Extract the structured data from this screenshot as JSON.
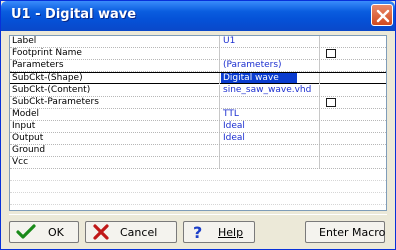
{
  "window": {
    "title": "U1 - Digital wave"
  },
  "properties": [
    {
      "label": "Label",
      "value": "U1",
      "checkbox": false
    },
    {
      "label": "Footprint Name",
      "value": "",
      "checkbox": true
    },
    {
      "label": "Parameters",
      "value": "(Parameters)",
      "checkbox": false
    },
    {
      "label": "SubCkt-(Shape)",
      "value": "Digital wave",
      "checkbox": false,
      "editing": true
    },
    {
      "label": "SubCkt-(Content)",
      "value": "sine_saw_wave.vhd",
      "checkbox": false
    },
    {
      "label": "SubCkt-Parameters",
      "value": "",
      "checkbox": true
    },
    {
      "label": "Model",
      "value": "TTL",
      "checkbox": false
    },
    {
      "label": "Input",
      "value": "Ideal",
      "checkbox": false
    },
    {
      "label": "Output",
      "value": "Ideal",
      "checkbox": false
    },
    {
      "label": "Ground",
      "value": "",
      "checkbox": false
    },
    {
      "label": "Vcc",
      "value": "",
      "checkbox": false
    }
  ],
  "buttons": {
    "ok": {
      "label": "OK",
      "icon": "checkmark-icon"
    },
    "cancel": {
      "label": "Cancel",
      "icon": "x-icon"
    },
    "help": {
      "label": "Help",
      "icon": "question-icon"
    },
    "enter_macro": {
      "label": "Enter Macro"
    }
  },
  "colors": {
    "value_text": "#1c2fd0",
    "editing_bg": "#0a3ccf",
    "titlebar": "#0552d8"
  }
}
